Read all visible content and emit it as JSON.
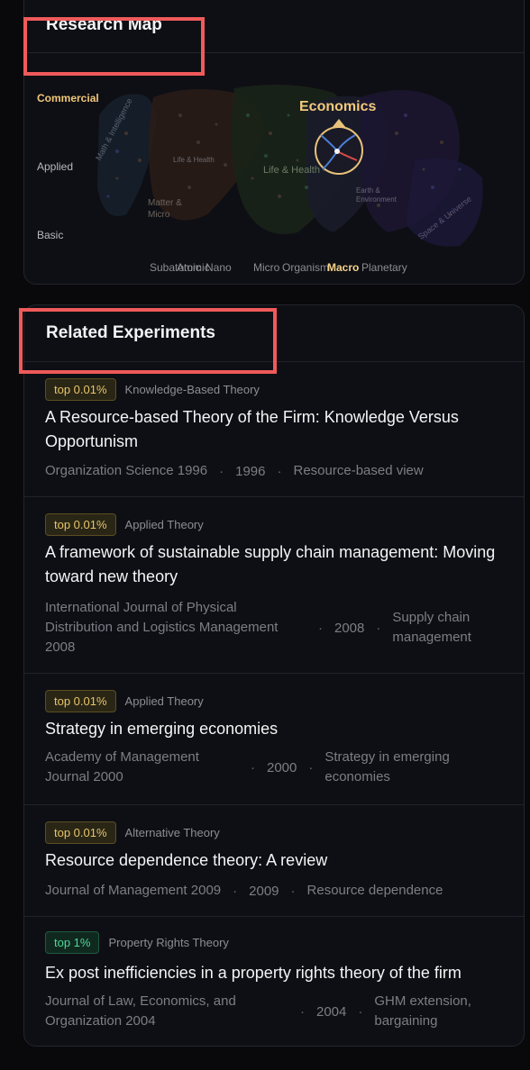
{
  "map": {
    "title": "Research Map",
    "y_labels": [
      "Commercial",
      "Applied",
      "Basic"
    ],
    "x_labels": [
      "Subatomic",
      "Atomic",
      "Nano",
      "Micro",
      "Organism",
      "Macro",
      "Planetary"
    ],
    "focus_label": "Economics",
    "region_labels": [
      "Math & Intelligence",
      "Life & Health",
      "Life & Health",
      "Matter & Micro",
      "Earth & Environment",
      "Space & Universe"
    ]
  },
  "experiments": {
    "title": "Related Experiments",
    "items": [
      {
        "rank": "top 0.01%",
        "category": "Knowledge-Based Theory",
        "title": "A Resource-based Theory of the Firm: Knowledge Versus Opportunism",
        "journal": "Organization Science 1996",
        "year": "1996",
        "topic": "Resource-based view"
      },
      {
        "rank": "top 0.01%",
        "category": "Applied Theory",
        "title": "A framework of sustainable supply chain management: Moving toward new theory",
        "journal": "International Journal of Physical Distribution and Logistics Management 2008",
        "year": "2008",
        "topic": "Supply chain management"
      },
      {
        "rank": "top 0.01%",
        "category": "Applied Theory",
        "title": "Strategy in emerging economies",
        "journal": "Academy of Management Journal 2000",
        "year": "2000",
        "topic": "Strategy in emerging economies"
      },
      {
        "rank": "top 0.01%",
        "category": "Alternative Theory",
        "title": "Resource dependence theory: A review",
        "journal": "Journal of Management 2009",
        "year": "2009",
        "topic": "Resource dependence"
      },
      {
        "rank": "top 1%",
        "category": "Property Rights Theory",
        "title": "Ex post inefficiencies in a property rights theory of the firm",
        "journal": "Journal of Law, Economics, and Organization 2004",
        "year": "2004",
        "topic": "GHM extension, bargaining"
      }
    ]
  },
  "colors": {
    "accent_gold": "#f3c97c",
    "highlight_red": "#ef5a5a",
    "badge_gold": "#e6c46a",
    "badge_green": "#4fd69a"
  }
}
